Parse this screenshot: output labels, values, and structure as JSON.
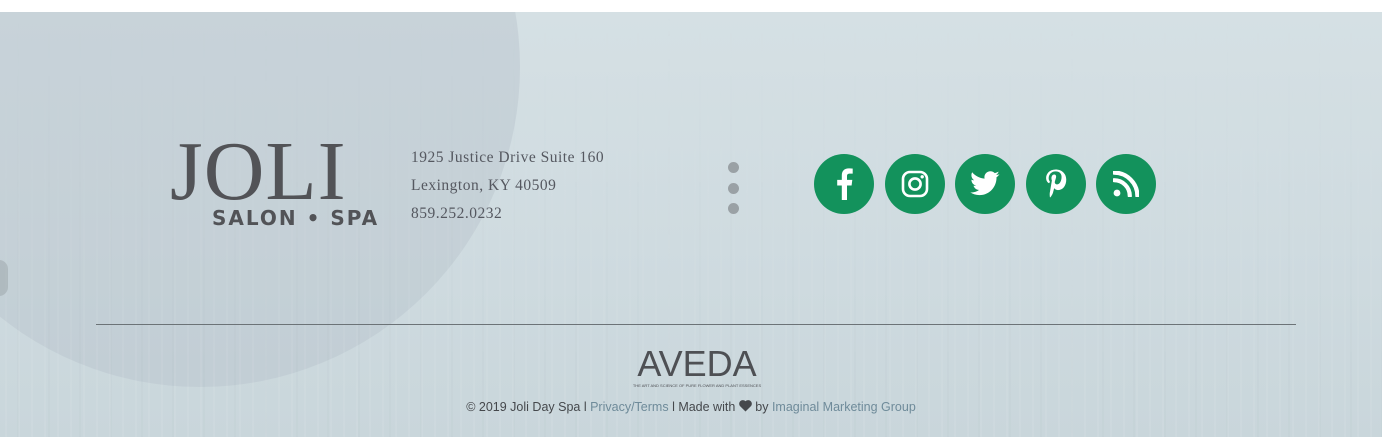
{
  "logo": {
    "main": "JOLI",
    "sub": "SALON • SPA"
  },
  "address": {
    "line1": "1925 Justice Drive Suite 160",
    "line2": "Lexington, KY 40509",
    "phone": "859.252.0232"
  },
  "social": {
    "icons": [
      "facebook-icon",
      "instagram-icon",
      "twitter-icon",
      "pinterest-icon",
      "rss-icon"
    ],
    "color": "#13925c"
  },
  "aveda": {
    "name": "AVEDA",
    "tagline": "THE ART AND SCIENCE OF PURE FLOWER AND PLANT ESSENCES"
  },
  "copyright": {
    "text": "© 2019 Joli Day Spa l",
    "privacy_link": "Privacy/Terms",
    "made_with": "l Made with",
    "by": "by",
    "agency_link": "Imaginal Marketing Group"
  },
  "colors": {
    "background": "#d3dee2",
    "text": "#525357",
    "link": "#6f8b9a"
  }
}
